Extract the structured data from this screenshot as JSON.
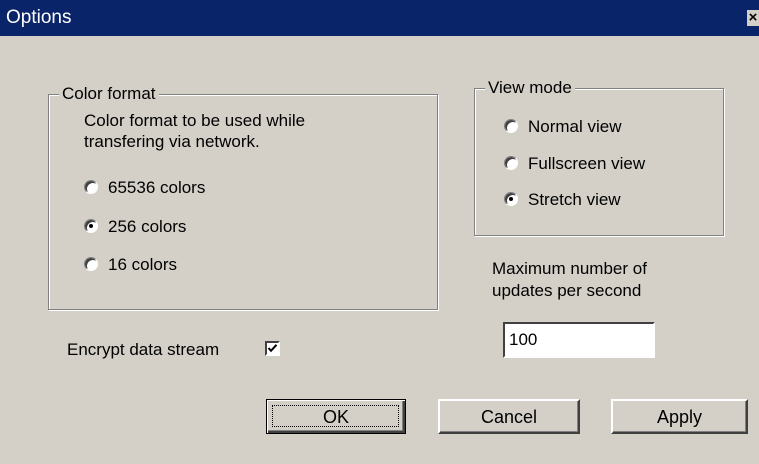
{
  "window": {
    "title": "Options",
    "close_glyph": "×"
  },
  "color_format": {
    "legend": "Color format",
    "description_line1": "Color format to be used while",
    "description_line2": "transfering via network.",
    "options": [
      {
        "label": "65536 colors",
        "selected": false
      },
      {
        "label": "256 colors",
        "selected": true
      },
      {
        "label": "16 colors",
        "selected": false
      }
    ]
  },
  "view_mode": {
    "legend": "View mode",
    "options": [
      {
        "label": "Normal view",
        "selected": false
      },
      {
        "label": "Fullscreen view",
        "selected": false
      },
      {
        "label": "Stretch view",
        "selected": true
      }
    ]
  },
  "updates": {
    "label_line1": "Maximum number of",
    "label_line2": "updates per second",
    "value": "100"
  },
  "encrypt": {
    "label": "Encrypt data stream",
    "checked": true
  },
  "buttons": {
    "ok": "OK",
    "cancel": "Cancel",
    "apply": "Apply"
  }
}
